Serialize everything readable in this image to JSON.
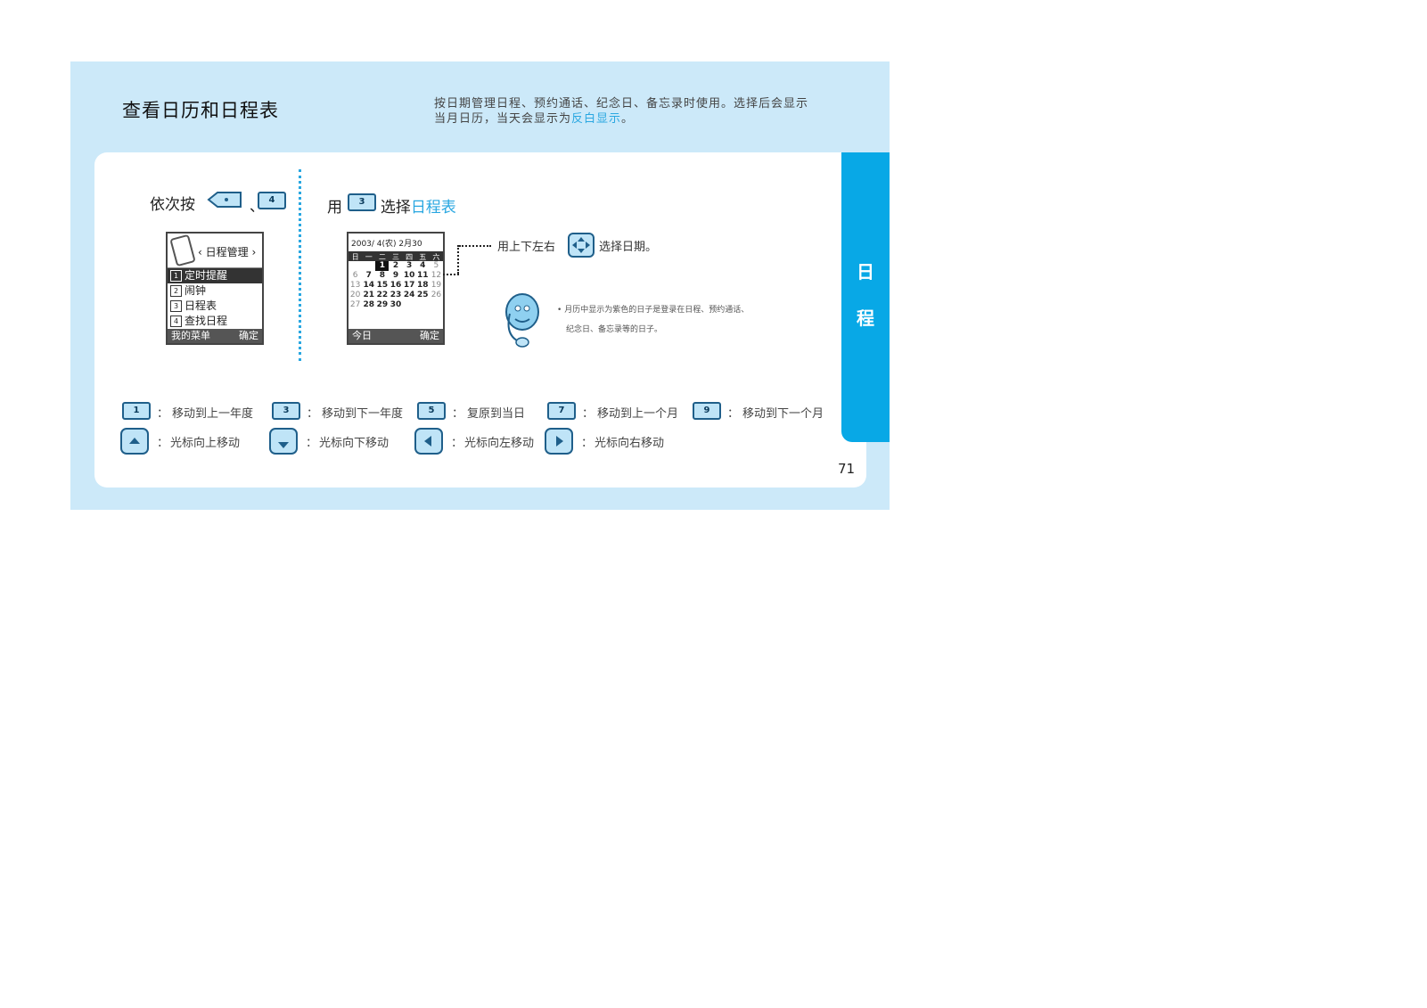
{
  "header": {
    "title": "查看日历和日程表",
    "intro_line1": "按日期管理日程、预约通话、纪念日、备忘录时使用。选择后会显示",
    "intro_line2_prefix": "当月日历，当天会显示为",
    "intro_line2_highlight": "反白显示",
    "intro_line2_suffix": "。"
  },
  "steps": {
    "step1_text": "依次按",
    "step1_sep": "、",
    "step1_key": "4",
    "step2_prefix": "用",
    "step2_key": "3",
    "step2_mid": "选择",
    "step2_highlight": "日程表"
  },
  "menu_screen": {
    "title": "日程管理",
    "items": [
      "定时提醒",
      "闹钟",
      "日程表",
      "查找日程"
    ],
    "numbers": [
      "1",
      "2",
      "3",
      "4"
    ],
    "left_soft": "我的菜单",
    "right_soft": "确定"
  },
  "calendar_screen": {
    "header": "2003/ 4(农) 2月30",
    "weekdays": [
      "日",
      "一",
      "二",
      "三",
      "四",
      "五",
      "六"
    ],
    "rows": [
      [
        "",
        "",
        "1",
        "2",
        "3",
        "4",
        "5"
      ],
      [
        "6",
        "7",
        "8",
        "9",
        "10",
        "11",
        "12"
      ],
      [
        "13",
        "14",
        "15",
        "16",
        "17",
        "18",
        "19"
      ],
      [
        "20",
        "21",
        "22",
        "23",
        "24",
        "25",
        "26"
      ],
      [
        "27",
        "28",
        "29",
        "30",
        "",
        "",
        ""
      ]
    ],
    "left_soft": "今日",
    "right_soft": "确定"
  },
  "notes": {
    "nav_prefix": "用上下左右",
    "nav_suffix": "选择日期。",
    "bullet": "•",
    "info_line1": "月历中显示为紫色的日子是登录在日程、预约通话、",
    "info_line2": "纪念日、备忘录等的日子。"
  },
  "legend": [
    {
      "key": "1",
      "colon": "：",
      "text": "移动到上一年度"
    },
    {
      "key": "3",
      "colon": "：",
      "text": "移动到下一年度"
    },
    {
      "key": "5",
      "colon": "：",
      "text": "复原到当日"
    },
    {
      "key": "7",
      "colon": "：",
      "text": "移动到上一个月"
    },
    {
      "key": "9",
      "colon": "：",
      "text": "移动到下一个月"
    }
  ],
  "nav_legend": [
    {
      "icon": "up-key-icon",
      "colon": "：",
      "text": "光标向上移动"
    },
    {
      "icon": "down-key-icon",
      "colon": "：",
      "text": "光标向下移动"
    },
    {
      "icon": "left-key-icon",
      "colon": "：",
      "text": "光标向左移动"
    },
    {
      "icon": "right-key-icon",
      "colon": "：",
      "text": "光标向右移动"
    }
  ],
  "side_tab": [
    "日",
    "程"
  ],
  "page_number": "71",
  "colors": {
    "accent": "#08a8e6",
    "background": "#cce9f9",
    "highlight": "#29a7e1"
  }
}
